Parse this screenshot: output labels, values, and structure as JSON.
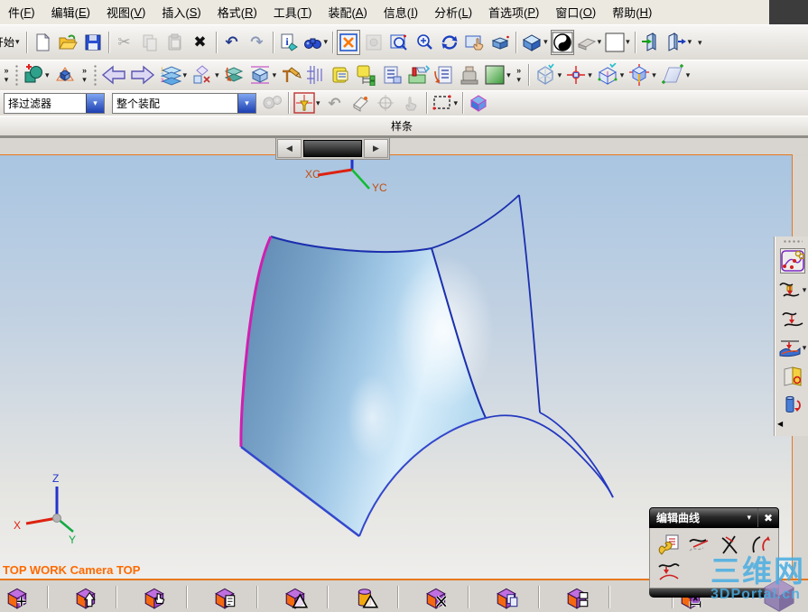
{
  "menu_bar": {
    "items": [
      {
        "pre": "件(",
        "key": "F",
        "post": ")"
      },
      {
        "pre": "编辑(",
        "key": "E",
        "post": ")"
      },
      {
        "pre": "视图(",
        "key": "V",
        "post": ")"
      },
      {
        "pre": "插入(",
        "key": "S",
        "post": ")"
      },
      {
        "pre": "格式(",
        "key": "R",
        "post": ")"
      },
      {
        "pre": "工具(",
        "key": "T",
        "post": ")"
      },
      {
        "pre": "装配(",
        "key": "A",
        "post": ")"
      },
      {
        "pre": "信息(",
        "key": "I",
        "post": ")"
      },
      {
        "pre": "分析(",
        "key": "L",
        "post": ")"
      },
      {
        "pre": "首选项(",
        "key": "P",
        "post": ")"
      },
      {
        "pre": "窗口(",
        "key": "O",
        "post": ")"
      },
      {
        "pre": "帮助(",
        "key": "H",
        "post": ")"
      }
    ]
  },
  "toolbar_main": {
    "start_label": "开始"
  },
  "selection_bar": {
    "filter_value": "择过滤器",
    "scope_value": "整个装配"
  },
  "spline_bar": {
    "label": "样条"
  },
  "viewport": {
    "status_text": "TOP WORK Camera TOP",
    "wcs": {
      "x": "XC",
      "y": "YC"
    },
    "triad": {
      "x": "X",
      "y": "Y",
      "z": "Z"
    }
  },
  "palette": {
    "title": "编辑曲线"
  },
  "watermark": {
    "title": "三维网",
    "subtitle": "3DPortal.cn"
  },
  "glyphs": {
    "caret": "▾",
    "overflow": "»",
    "undo": "↶",
    "redo": "↷",
    "cut": "✂",
    "delete": "✖",
    "close": "✖",
    "scroll_left": "◀",
    "scroll_right": "▶",
    "collapse_left": "◀"
  },
  "colors": {
    "viewport_border": "#e8781e",
    "status_text": "#ff6a00",
    "surface_edge": "#1b2fae",
    "surface_seam": "#d01fb0",
    "watermark": "#49ade2"
  }
}
